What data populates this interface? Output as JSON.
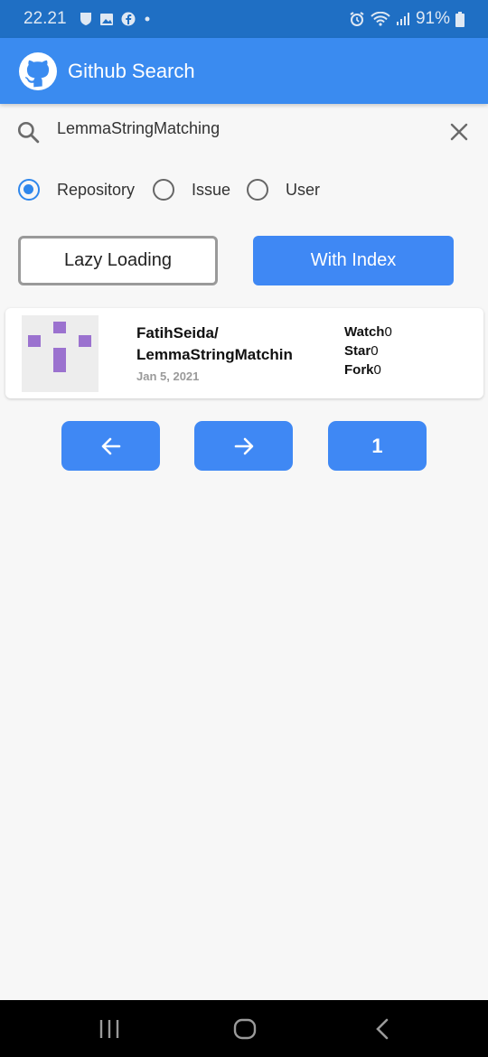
{
  "status_bar": {
    "time": "22.21",
    "battery": "91%",
    "icons": [
      "shield-icon",
      "image-icon",
      "facebook-icon",
      "dot-icon",
      "alarm-icon",
      "wifi-icon",
      "signal-icon",
      "battery-icon"
    ]
  },
  "app_bar": {
    "title": "Github Search",
    "logo_icon": "github-icon"
  },
  "search": {
    "value": "LemmaStringMatching",
    "search_icon": "search-icon",
    "clear_icon": "close-icon"
  },
  "search_type": {
    "selected": "Repository",
    "options": [
      "Repository",
      "Issue",
      "User"
    ]
  },
  "mode_buttons": {
    "lazy_label": "Lazy Loading",
    "index_label": "With Index"
  },
  "results": [
    {
      "owner": "FatihSeida/",
      "name": "LemmaStringMatchin",
      "date": "Jan 5, 2021",
      "watch_label": "Watch",
      "watch_count": "0",
      "star_label": "Star",
      "star_count": "0",
      "fork_label": "Fork",
      "fork_count": "0"
    }
  ],
  "pagination": {
    "prev_icon": "arrow-left-icon",
    "next_icon": "arrow-right-icon",
    "page": "1"
  },
  "colors": {
    "status_bar": "#1f6fc4",
    "app_bar": "#3a8bf0",
    "accent": "#3f88f4",
    "background": "#f7f7f7",
    "avatar_identicon": "#9b72cf"
  }
}
